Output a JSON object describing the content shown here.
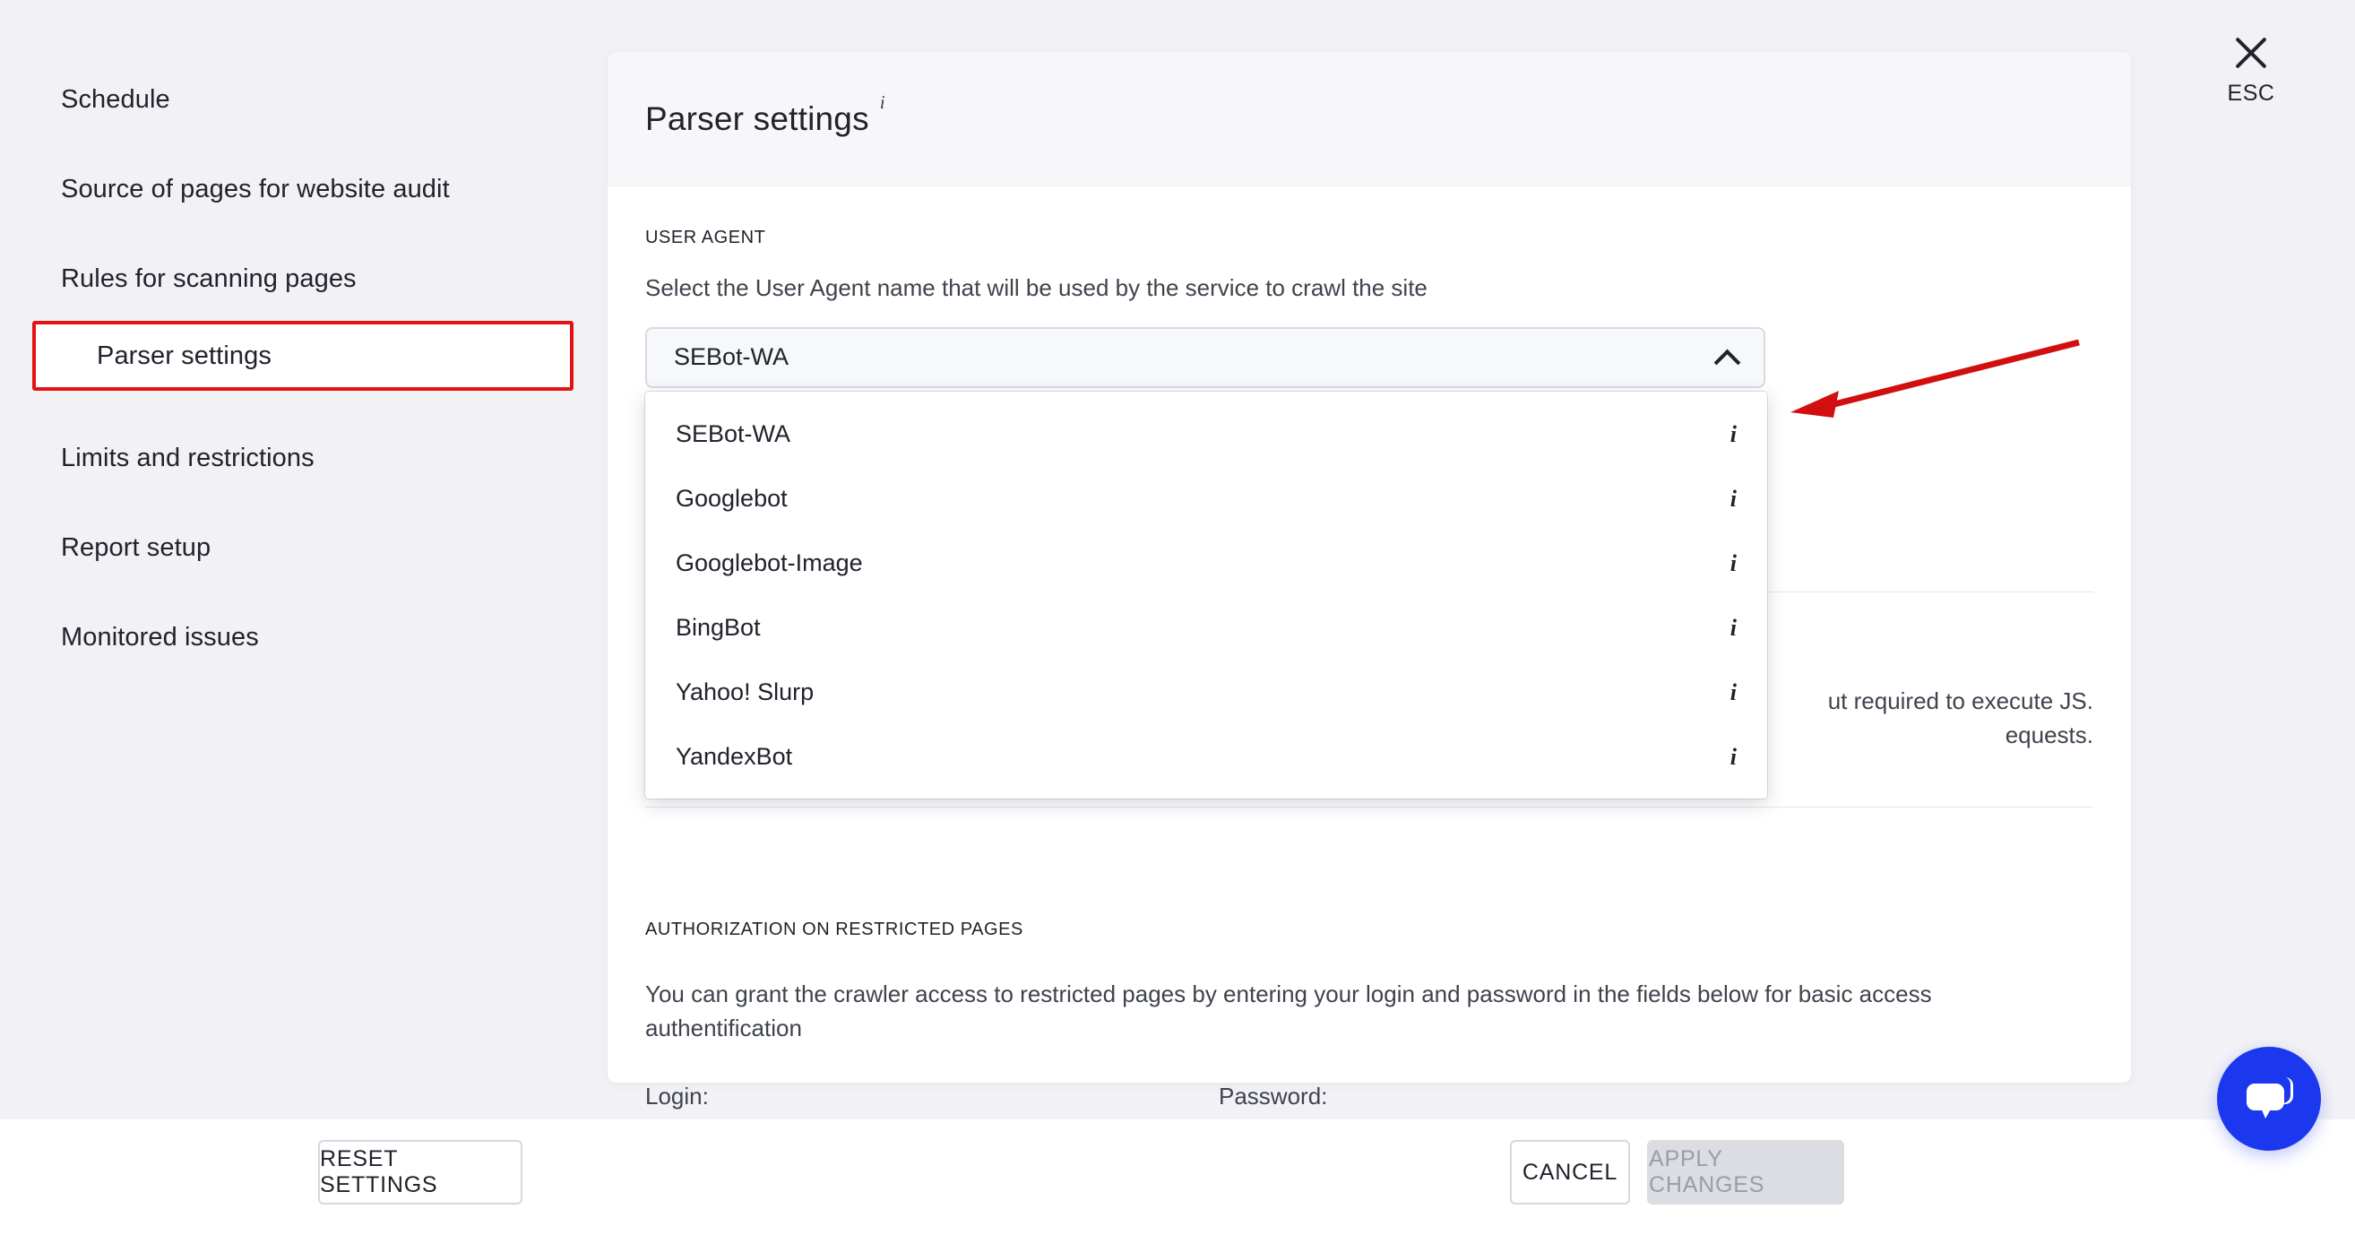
{
  "sidebar": {
    "items": [
      {
        "label": "Schedule"
      },
      {
        "label": "Source of pages for website audit"
      },
      {
        "label": "Rules for scanning pages"
      },
      {
        "label": "Parser settings"
      },
      {
        "label": "Limits and restrictions"
      },
      {
        "label": "Report setup"
      },
      {
        "label": "Monitored issues"
      }
    ]
  },
  "dialog": {
    "title": "Parser settings",
    "title_info_icon": "info-icon",
    "close": {
      "icon": "close-icon",
      "label": "ESC"
    }
  },
  "user_agent": {
    "section_label": "USER AGENT",
    "description": "Select the User Agent name that will be used by the service to crawl the site",
    "selected": "SEBot-WA",
    "chevron_icon": "chevron-up-icon",
    "options": [
      {
        "label": "SEBot-WA",
        "info_icon": "info-icon"
      },
      {
        "label": "Googlebot",
        "info_icon": "info-icon"
      },
      {
        "label": "Googlebot-Image",
        "info_icon": "info-icon"
      },
      {
        "label": "BingBot",
        "info_icon": "info-icon"
      },
      {
        "label": "Yahoo! Slurp",
        "info_icon": "info-icon"
      },
      {
        "label": "YandexBot",
        "info_icon": "info-icon"
      }
    ]
  },
  "obscured": {
    "js_text_line1": "ut required to execute JS.",
    "js_text_line2": "equests."
  },
  "authorization": {
    "section_label": "AUTHORIZATION ON RESTRICTED PAGES",
    "description": "You can grant the crawler access to restricted pages by entering your login and password in the fields below for basic access authentification",
    "login_label": "Login:",
    "login_value": "",
    "password_label": "Password:",
    "password_value": ""
  },
  "footer": {
    "reset_label": "RESET SETTINGS",
    "cancel_label": "CANCEL",
    "apply_label": "APPLY CHANGES"
  },
  "chat": {
    "icon": "chat-bubble-icon"
  },
  "annotation": {
    "arrow_color": "#d10f0f"
  },
  "colors": {
    "page_background": "#f2f2f6",
    "card_background": "#ffffff",
    "highlight_red": "#e31313",
    "chat_blue": "#1b38ef",
    "disabled_grey": "#dcdde2"
  }
}
